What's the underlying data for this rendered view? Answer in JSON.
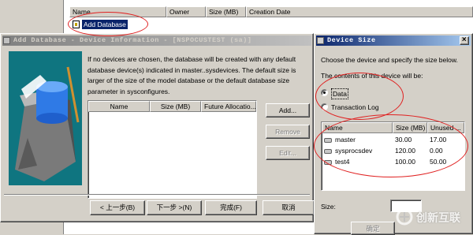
{
  "background_list": {
    "columns": [
      "Name",
      "Owner",
      "Size (MB)",
      "Creation Date"
    ],
    "selected_item": "Add Database"
  },
  "add_db_dialog": {
    "title": "Add Database - Device Information - [NSPOCUSTEST (sa)]",
    "description": "If no devices are chosen, the database will be created with any default database device(s) indicated in master..sysdevices. The default size is larger of the size of the model database or the default database size parameter in sysconfigures.",
    "columns": [
      "Name",
      "Size (MB)",
      "Future Allocatio..."
    ],
    "buttons": {
      "add": "Add...",
      "remove": "Remove",
      "edit": "Edit..."
    },
    "nav": {
      "back": "< 上一步(B)",
      "next": "下一步 >(N)",
      "finish": "完成(F)",
      "cancel": "取消"
    }
  },
  "device_size_dialog": {
    "title": "Device Size",
    "close": "×",
    "instruction": "Choose the device and specify the size below.",
    "contents_label": "The contents of this device will be:",
    "options": [
      {
        "label": "Data",
        "selected": true
      },
      {
        "label": "Transaction Log",
        "selected": false
      }
    ],
    "columns": [
      "Name",
      "Size (MB)",
      "Unused ..."
    ],
    "rows": [
      {
        "name": "master",
        "size": "30.00",
        "unused": "17.00"
      },
      {
        "name": "sysprocsdev",
        "size": "120.00",
        "unused": "0.00"
      },
      {
        "name": "test4",
        "size": "100.00",
        "unused": "50.00"
      }
    ],
    "size_label": "Size:",
    "ok_button": "确定"
  },
  "watermark": {
    "text": "创新互联"
  },
  "colors": {
    "title_active": "#0a246a",
    "title_inactive": "#808080",
    "annotation": "#e02020"
  }
}
